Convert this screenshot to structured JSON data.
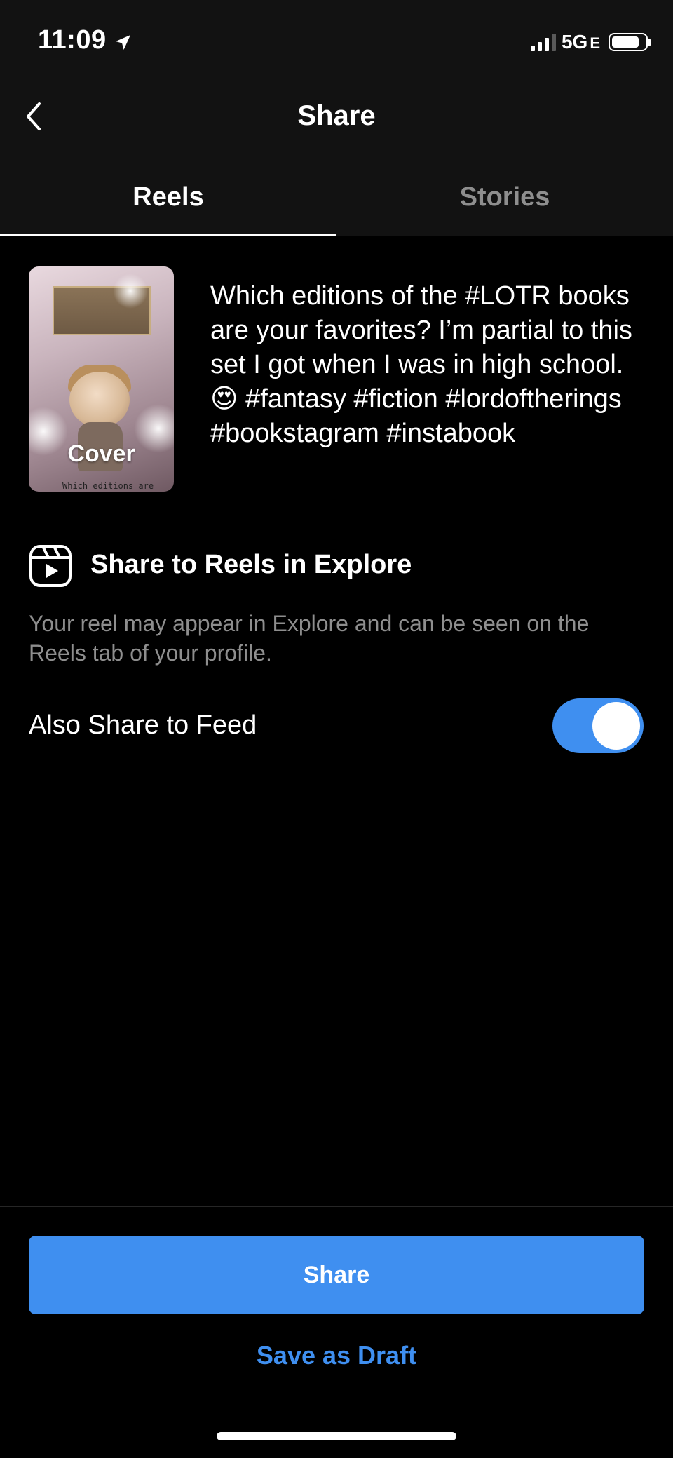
{
  "status_bar": {
    "time": "11:09",
    "network": "5G",
    "network_suffix": "E"
  },
  "nav": {
    "title": "Share"
  },
  "tabs": [
    {
      "label": "Reels",
      "active": true
    },
    {
      "label": "Stories",
      "active": false
    }
  ],
  "post": {
    "cover_label": "Cover",
    "cover_subtext": "Which editions are",
    "caption": "Which editions of the #LOTR books are your favorites? I’m partial to this set I got when I was in high school. 😍 #fantasy #fiction #lordoftherings #bookstagram #instabook"
  },
  "explore": {
    "title": "Share to Reels in Explore",
    "description": "Your reel may appear in Explore and can be seen on the Reels tab of your profile."
  },
  "feed_toggle": {
    "label": "Also Share to Feed",
    "enabled": true
  },
  "actions": {
    "share_label": "Share",
    "draft_label": "Save as Draft"
  },
  "colors": {
    "accent": "#3f8ff0",
    "header_bg": "#121212",
    "secondary_text": "#8e8e8e"
  }
}
